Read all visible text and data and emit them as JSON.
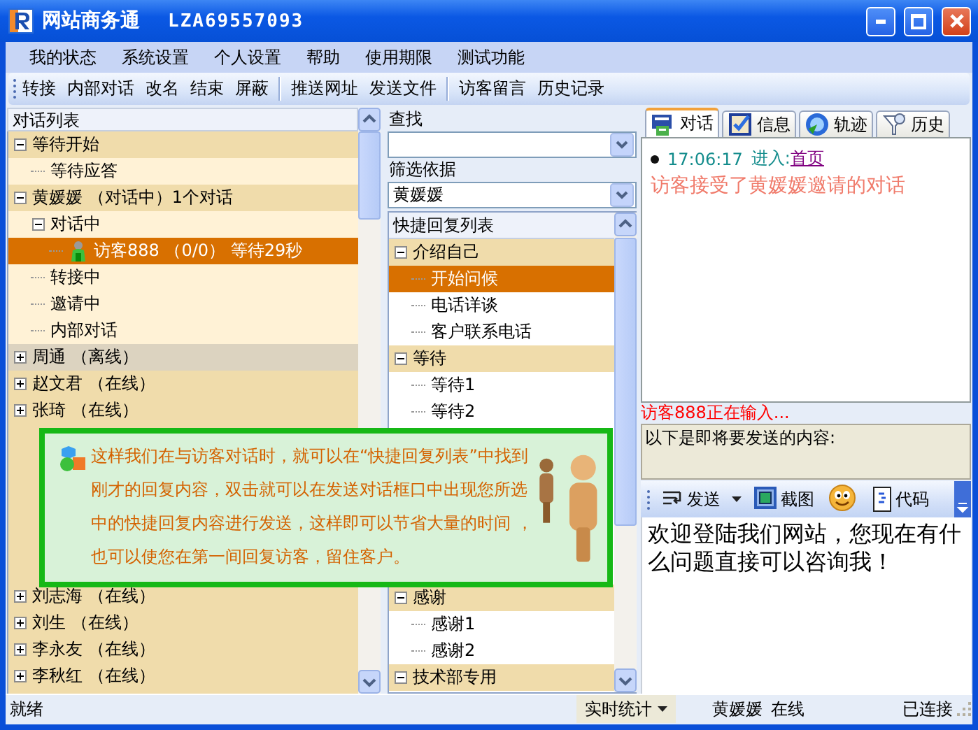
{
  "window": {
    "title": "网站商务通",
    "account": "LZA69557093"
  },
  "menu": [
    "我的状态",
    "系统设置",
    "个人设置",
    "帮助",
    "使用期限",
    "测试功能"
  ],
  "toolbar": [
    {
      "items": [
        "转接",
        "内部对话",
        "改名",
        "结束",
        "屏蔽"
      ]
    },
    {
      "items": [
        "推送网址",
        "发送文件"
      ]
    },
    {
      "items": [
        "访客留言",
        "历史记录"
      ]
    }
  ],
  "conversation_list": {
    "title": "对话列表",
    "groups": [
      {
        "label": "等待开始",
        "expanded": true,
        "offline": false,
        "selected": false,
        "children": [
          {
            "label": "等待应答",
            "selected": false
          }
        ]
      },
      {
        "label": "黄媛媛 （对话中）1个对话",
        "expanded": true,
        "offline": false,
        "selected": false,
        "children": [
          {
            "label": "对话中",
            "expanded": true,
            "selected": false,
            "children": [
              {
                "label": "访客888 （0/0） 等待29秒",
                "kind": "visitor",
                "selected": true
              }
            ]
          },
          {
            "label": "转接中",
            "selected": false
          },
          {
            "label": "邀请中",
            "selected": false
          },
          {
            "label": "内部对话",
            "selected": false
          }
        ]
      },
      {
        "label": "周通 （离线）",
        "expanded": false,
        "offline": true,
        "selected": false
      },
      {
        "label": "赵文君 （在线）",
        "expanded": false,
        "offline": false,
        "selected": false
      },
      {
        "label": "张琦 （在线）",
        "expanded": false,
        "offline": false,
        "selected": false
      },
      {
        "label": "刘志海 （在线）",
        "expanded": false,
        "offline": false,
        "selected": false
      },
      {
        "label": "刘生 （在线）",
        "expanded": false,
        "offline": false,
        "selected": false
      },
      {
        "label": "李永友 （在线）",
        "expanded": false,
        "offline": false,
        "selected": false
      },
      {
        "label": "李秋红 （在线）",
        "expanded": false,
        "offline": false,
        "selected": false
      }
    ]
  },
  "search": {
    "label": "查找"
  },
  "filter": {
    "label": "筛选依据",
    "value": "黄媛媛"
  },
  "quick_replies": {
    "title": "快捷回复列表",
    "groups": [
      {
        "label": "介绍自己",
        "expanded": true,
        "selected": false,
        "children": [
          {
            "label": "开始问候",
            "selected": true
          },
          {
            "label": "电话详谈",
            "selected": false
          },
          {
            "label": "客户联系电话",
            "selected": false
          }
        ]
      },
      {
        "label": "等待",
        "expanded": true,
        "selected": false,
        "children": [
          {
            "label": "等待1",
            "selected": false
          },
          {
            "label": "等待2",
            "selected": false
          }
        ]
      },
      {
        "label": "感谢",
        "expanded": true,
        "selected": false,
        "children": [
          {
            "label": "感谢1",
            "selected": false
          },
          {
            "label": "感谢2",
            "selected": false
          }
        ]
      },
      {
        "label": "技术部专用",
        "expanded": true,
        "selected": false
      }
    ]
  },
  "tip": {
    "text": "这样我们在与访客对话时，就可以在“快捷回复列表”中找到刚才的回复内容，双击就可以在发送对话框口中出现您所选中的快捷回复内容进行发送，这样即可以节省大量的时间 ，也可以使您在第一间回复访客，留住客户。"
  },
  "tabs": [
    {
      "label": "对话",
      "kind": "chat",
      "selected": true
    },
    {
      "label": "信息",
      "kind": "info",
      "selected": false
    },
    {
      "label": "轨迹",
      "kind": "track",
      "selected": false
    },
    {
      "label": "历史",
      "kind": "history",
      "selected": false
    }
  ],
  "chat": {
    "messages": [
      {
        "kind": "visit",
        "time": "17:06:17",
        "action": "进入:",
        "link": "首页"
      },
      {
        "kind": "notice",
        "text": "访客接受了黄媛媛邀请的对话"
      }
    ],
    "typing": "访客888正在输入...",
    "preview": "以下是即将要发送的内容:"
  },
  "compose_toolbar": [
    {
      "kind": "send",
      "label": "发送"
    },
    {
      "kind": "screenshot",
      "label": "截图"
    },
    {
      "kind": "emoji"
    },
    {
      "kind": "code",
      "label": "代码"
    }
  ],
  "compose": {
    "value": "欢迎登陆我们网站，您现在有什么问题直接可以咨询我！"
  },
  "status_bar": {
    "status": "就绪",
    "stats": "实时统计",
    "user": "黄媛媛",
    "presence": "在线",
    "connection": "已连接"
  }
}
